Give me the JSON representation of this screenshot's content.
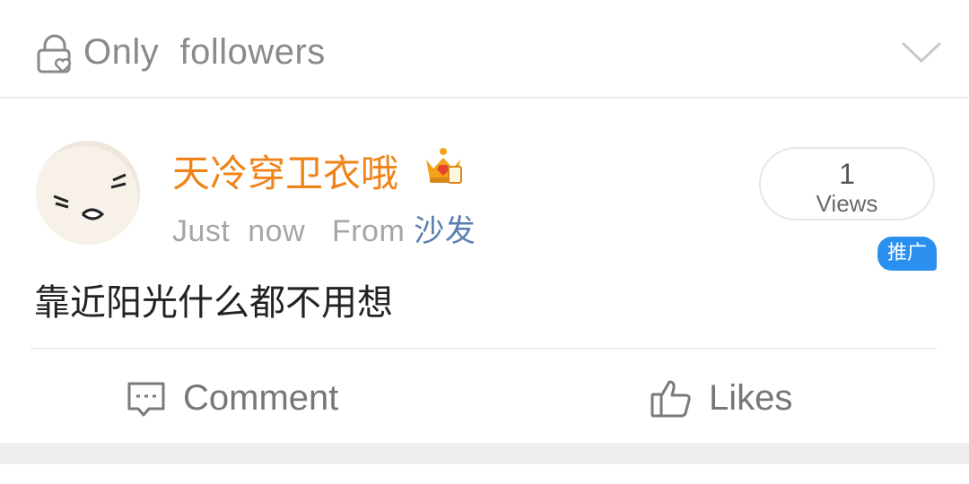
{
  "visibility": {
    "label": "Only  followers",
    "icon": "lock-heart-icon",
    "dropdown_icon": "chevron-down-icon"
  },
  "post": {
    "username": "天冷穿卫衣哦",
    "badge_icon": "crown-icon",
    "time": "Just  now",
    "from_label": "From",
    "source": "沙发",
    "views": {
      "count": "1",
      "label": "Views"
    },
    "promo_badge": "推广",
    "text": "靠近阳光什么都不用想"
  },
  "actions": {
    "comment_label": "Comment",
    "likes_label": "Likes"
  },
  "colors": {
    "username": "#f08318",
    "source_link": "#5b7eb0",
    "promo_badge": "#2b8ff0",
    "muted_text": "#a6a6a6"
  }
}
